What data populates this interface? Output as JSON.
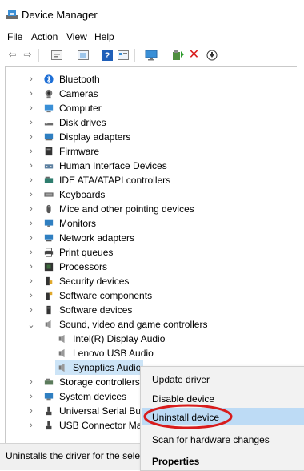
{
  "window": {
    "title": "Device Manager"
  },
  "menu": [
    "File",
    "Action",
    "View",
    "Help"
  ],
  "toolbar_icons": [
    "back-icon",
    "forward-icon",
    "properties-icon",
    "scan-icon",
    "help-icon",
    "view-icon",
    "monitor-icon",
    "update-driver-icon",
    "uninstall-icon",
    "download-icon"
  ],
  "tree": {
    "categories": [
      {
        "label": "Bluetooth",
        "icon": "bluetooth-icon",
        "color": "#1e6fd6"
      },
      {
        "label": "Cameras",
        "icon": "camera-icon",
        "color": "#555555"
      },
      {
        "label": "Computer",
        "icon": "computer-icon",
        "color": "#3a8fd6"
      },
      {
        "label": "Disk drives",
        "icon": "disk-icon",
        "color": "#666666"
      },
      {
        "label": "Display adapters",
        "icon": "display-adapter-icon",
        "color": "#2f7fc1"
      },
      {
        "label": "Firmware",
        "icon": "firmware-icon",
        "color": "#333333"
      },
      {
        "label": "Human Interface Devices",
        "icon": "hid-icon",
        "color": "#5b7fa0"
      },
      {
        "label": "IDE ATA/ATAPI controllers",
        "icon": "ide-icon",
        "color": "#2e7d6e"
      },
      {
        "label": "Keyboards",
        "icon": "keyboard-icon",
        "color": "#555555"
      },
      {
        "label": "Mice and other pointing devices",
        "icon": "mouse-icon",
        "color": "#555555"
      },
      {
        "label": "Monitors",
        "icon": "monitor-icon",
        "color": "#2f7fc1"
      },
      {
        "label": "Network adapters",
        "icon": "network-icon",
        "color": "#2f7fc1"
      },
      {
        "label": "Print queues",
        "icon": "printer-icon",
        "color": "#444444"
      },
      {
        "label": "Processors",
        "icon": "processor-icon",
        "color": "#3d6b3d"
      },
      {
        "label": "Security devices",
        "icon": "security-icon",
        "color": "#b07b1e"
      },
      {
        "label": "Software components",
        "icon": "software-component-icon",
        "color": "#555555"
      },
      {
        "label": "Software devices",
        "icon": "software-device-icon",
        "color": "#444444"
      },
      {
        "label": "Sound, video and game controllers",
        "icon": "speaker-icon",
        "color": "#666666"
      }
    ],
    "audio_children": [
      "Intel(R) Display Audio",
      "Lenovo USB Audio",
      "Synaptics Audio"
    ],
    "after": [
      {
        "label": "Storage controllers",
        "icon": "storage-icon",
        "color": "#5b7b5b"
      },
      {
        "label": "System devices",
        "icon": "system-icon",
        "color": "#2f7fc1"
      },
      {
        "label": "Universal Serial Bus controllers",
        "icon": "usb-icon",
        "color": "#444444"
      },
      {
        "label": "USB Connector Managers",
        "icon": "usb-connector-icon",
        "color": "#444444"
      }
    ]
  },
  "context_menu": {
    "items": [
      "Update driver",
      "Disable device",
      "Uninstall device",
      "Scan for hardware changes",
      "Properties"
    ],
    "highlight_color": "#d81c1c"
  },
  "status": {
    "text": "Uninstalls the driver for the selected device."
  }
}
